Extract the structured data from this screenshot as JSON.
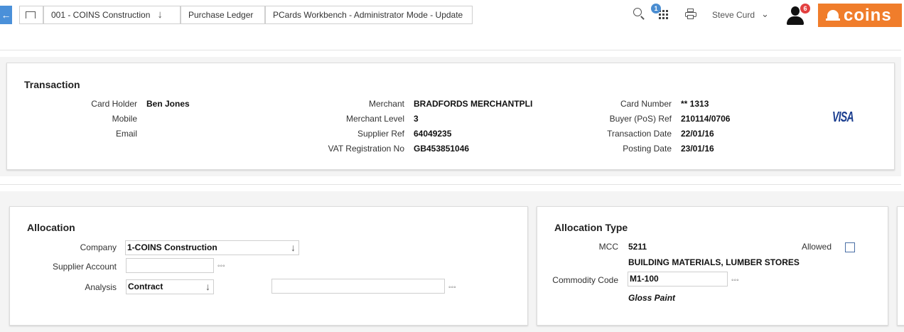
{
  "topbar": {
    "back_icon": "arrow-left-icon",
    "home_icon": "home-frame-icon",
    "crumb_company": "001 - COINS Construction",
    "crumb_ledger": "Purchase Ledger",
    "crumb_page": "PCards Workbench - Administrator Mode - Update",
    "apps_badge": "1",
    "user_name": "Steve Curd",
    "notifications_badge": "6",
    "logo_text": "coins",
    "accent_color": "#f07d2b"
  },
  "transaction": {
    "title": "Transaction",
    "card_holder_label": "Card Holder",
    "card_holder": "Ben Jones",
    "mobile_label": "Mobile",
    "email_label": "Email",
    "merchant_label": "Merchant",
    "merchant": "BRADFORDS MERCHANTPLI",
    "merchant_level_label": "Merchant Level",
    "merchant_level": "3",
    "supplier_ref_label": "Supplier Ref",
    "supplier_ref": "64049235",
    "vat_label": "VAT Registration No",
    "vat": "GB453851046",
    "card_number_label": "Card Number",
    "card_number": "** 1313",
    "buyer_ref_label": "Buyer (PoS) Ref",
    "buyer_ref": "210114/0706",
    "transaction_date_label": "Transaction Date",
    "transaction_date": "22/01/16",
    "posting_date_label": "Posting Date",
    "posting_date": "23/01/16",
    "card_brand": "VISA"
  },
  "allocation": {
    "title": "Allocation",
    "company_label": "Company",
    "company_value": "1-COINS Construction",
    "supplier_account_label": "Supplier Account",
    "supplier_account_value": "",
    "analysis_label": "Analysis",
    "analysis_value": "Contract",
    "analysis_code_value": ""
  },
  "allocation_type": {
    "title": "Allocation Type",
    "mcc_label": "MCC",
    "mcc": "5211",
    "mcc_desc": "BUILDING MATERIALS, LUMBER STORES",
    "allowed_label": "Allowed",
    "allowed_checked": false,
    "commodity_label": "Commodity Code",
    "commodity_value": "M1-100",
    "commodity_desc": "Gloss Paint"
  }
}
